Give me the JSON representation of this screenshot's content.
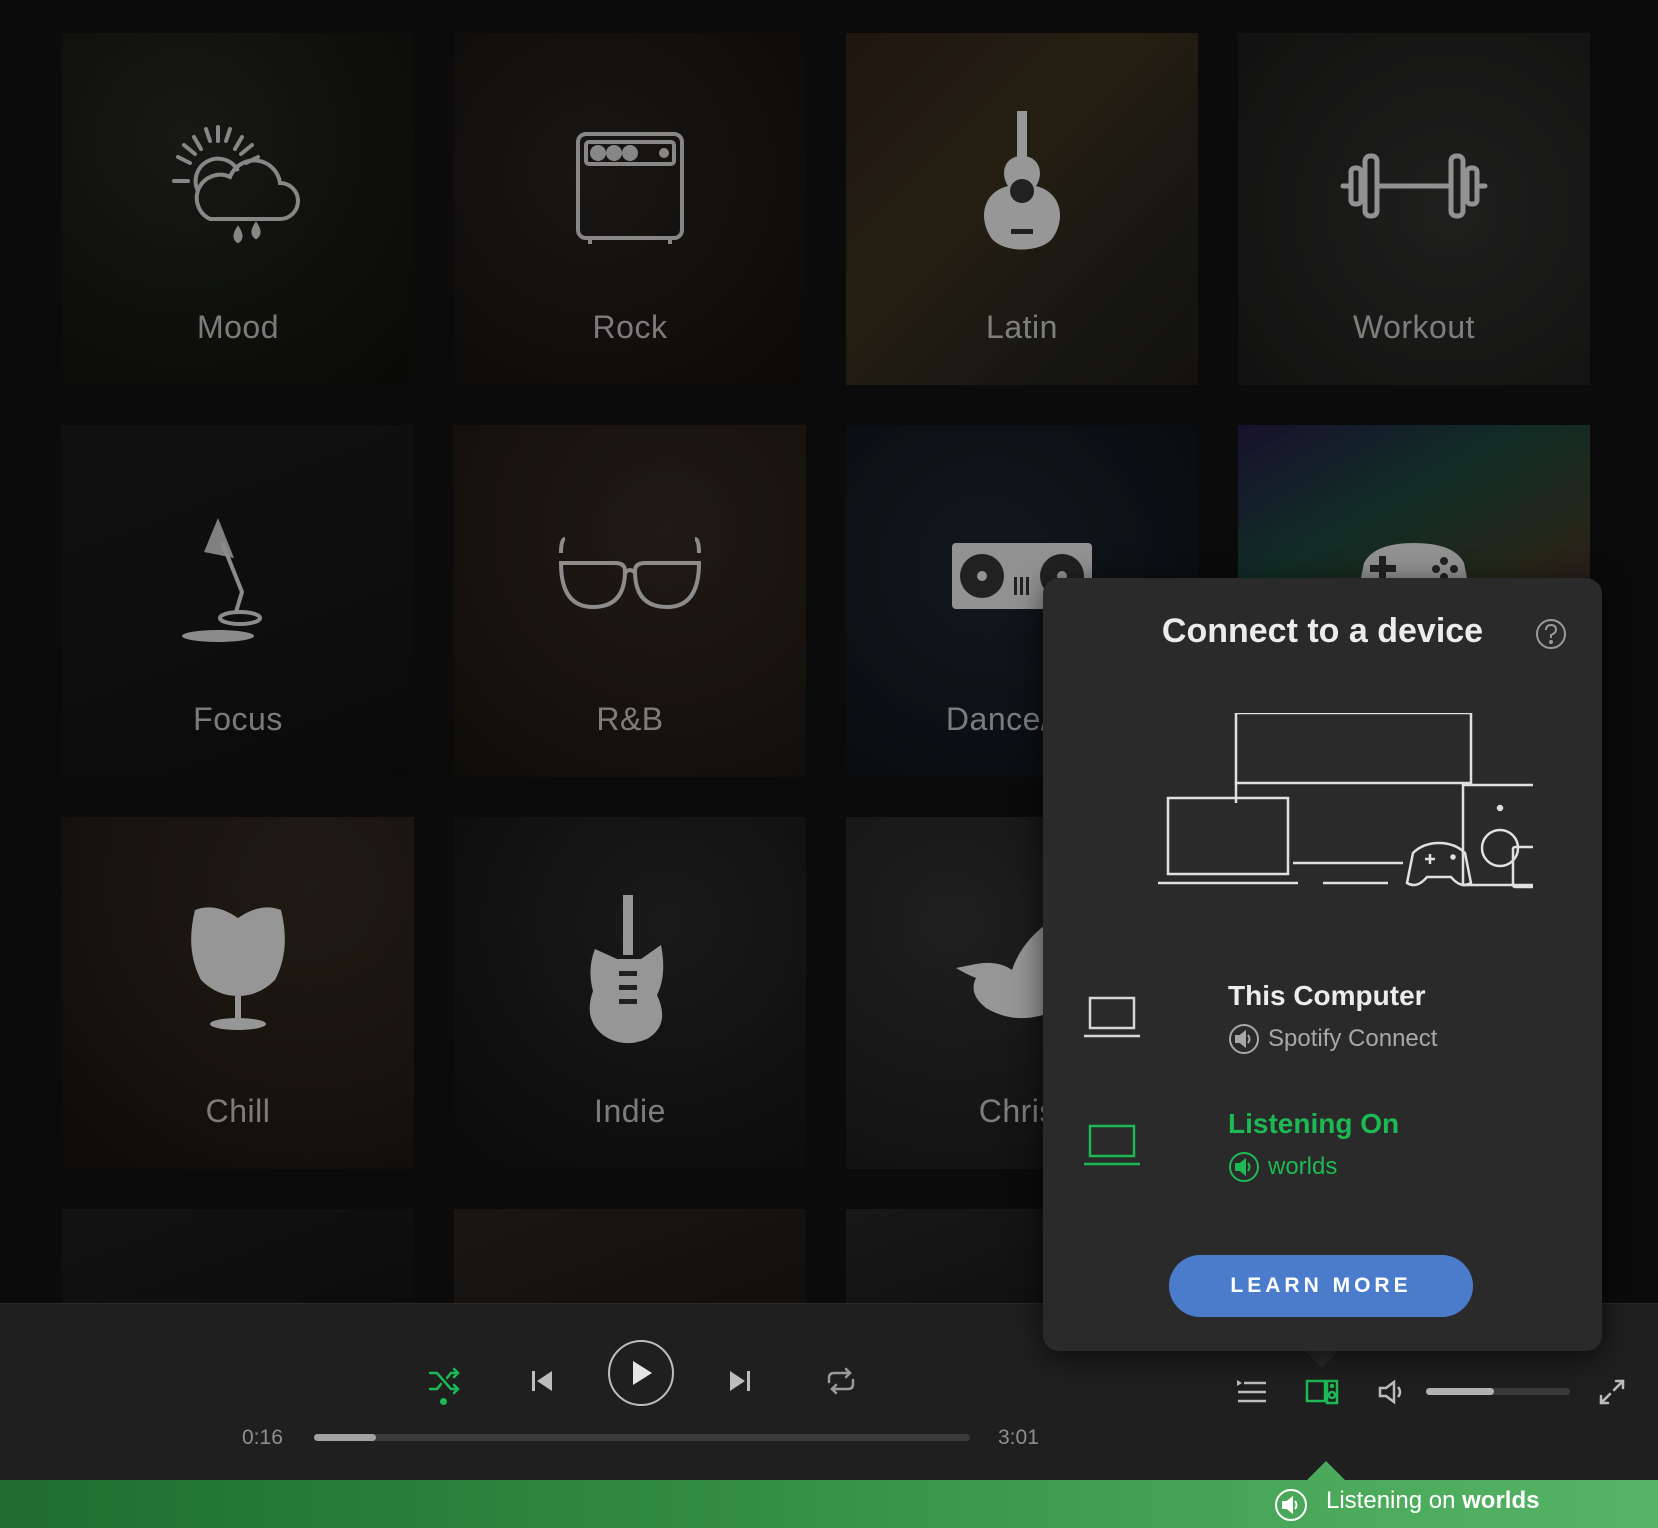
{
  "genres": [
    {
      "label": "Mood",
      "icon": "weather-mood-icon"
    },
    {
      "label": "Rock",
      "icon": "amplifier-icon"
    },
    {
      "label": "Latin",
      "icon": "acoustic-guitar-icon"
    },
    {
      "label": "Workout",
      "icon": "dumbbell-icon"
    },
    {
      "label": "Focus",
      "icon": "desk-lamp-icon"
    },
    {
      "label": "R&B",
      "icon": "sunglasses-icon"
    },
    {
      "label": "Dance/Ele",
      "icon": "turntable-icon"
    },
    {
      "label": "",
      "icon": "gamepad-icon"
    },
    {
      "label": "Chill",
      "icon": "egg-chair-icon"
    },
    {
      "label": "Indie",
      "icon": "electric-guitar-icon"
    },
    {
      "label": "Christ",
      "icon": "dove-icon"
    }
  ],
  "player": {
    "elapsed": "0:16",
    "duration": "3:01",
    "progress_fraction": 0.095,
    "volume_fraction": 0.47,
    "shuffle_active": true,
    "accent": "#1db954"
  },
  "connect": {
    "title": "Connect to a device",
    "devices": [
      {
        "name": "This Computer",
        "sub": "Spotify Connect",
        "active": false
      },
      {
        "name": "Listening On",
        "sub": "worlds",
        "active": true
      }
    ],
    "learn_more": "LEARN MORE",
    "button_color": "#4b7ccc"
  },
  "status": {
    "prefix": "Listening on",
    "device": "worlds"
  }
}
